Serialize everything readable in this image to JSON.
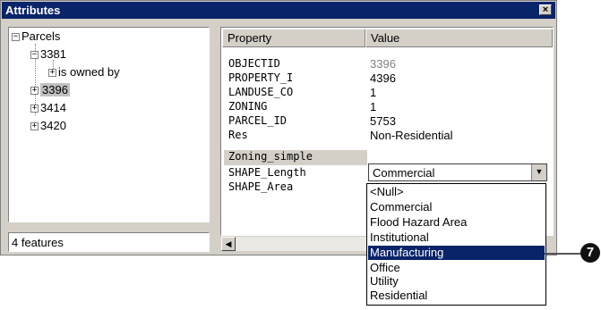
{
  "window": {
    "title": "Attributes"
  },
  "tree": {
    "root": "Parcels",
    "nodes": [
      {
        "label": "3381",
        "expanded": true
      },
      {
        "label": "is owned by",
        "child": true
      },
      {
        "label": "3396",
        "selected": true
      },
      {
        "label": "3414"
      },
      {
        "label": "3420"
      }
    ]
  },
  "status": {
    "text": "4 features"
  },
  "grid": {
    "headers": {
      "property": "Property",
      "value": "Value"
    },
    "rows": [
      {
        "property": "OBJECTID",
        "value": "3396"
      },
      {
        "property": "PROPERTY_I",
        "value": "4396"
      },
      {
        "property": "LANDUSE_CO",
        "value": "1"
      },
      {
        "property": "ZONING",
        "value": "1"
      },
      {
        "property": "PARCEL_ID",
        "value": "5753"
      },
      {
        "property": "Res",
        "value": "Non-Residential"
      },
      {
        "property": "Zoning_simple",
        "value": "Commercial"
      },
      {
        "property": "SHAPE_Length",
        "value": ""
      },
      {
        "property": "SHAPE_Area",
        "value": ""
      }
    ]
  },
  "dropdown": {
    "options": [
      "<Null>",
      "Commercial",
      "Flood Hazard Area",
      "Institutional",
      "Manufacturing",
      "Office",
      "Utility",
      "Residential"
    ],
    "highlighted": "Manufacturing"
  },
  "callout": {
    "number": "7"
  }
}
